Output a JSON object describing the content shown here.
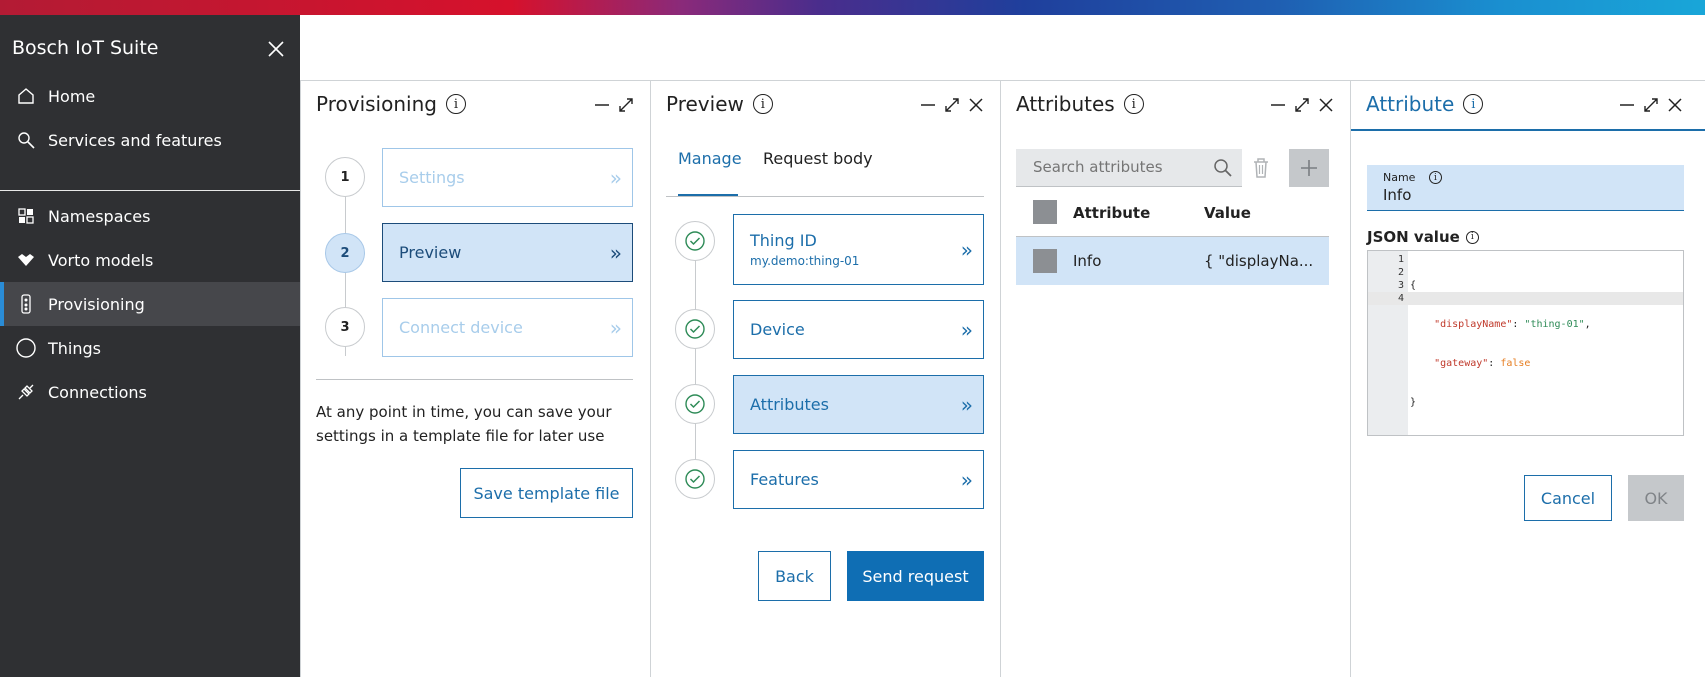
{
  "sidebar": {
    "brand": "Bosch IoT Suite",
    "items": [
      {
        "label": "Home",
        "icon": "home-icon"
      },
      {
        "label": "Services and features",
        "icon": "search-icon"
      },
      {
        "label": "Namespaces",
        "icon": "namespaces-icon"
      },
      {
        "label": "Vorto models",
        "icon": "vorto-icon"
      },
      {
        "label": "Provisioning",
        "icon": "provisioning-icon",
        "active": true
      },
      {
        "label": "Things",
        "icon": "things-icon"
      },
      {
        "label": "Connections",
        "icon": "connections-icon"
      }
    ]
  },
  "provisioning": {
    "title": "Provisioning",
    "steps": [
      {
        "number": "1",
        "label": "Settings"
      },
      {
        "number": "2",
        "label": "Preview"
      },
      {
        "number": "3",
        "label": "Connect device"
      }
    ],
    "note": "At any point in time, you can save your settings in a template file for later use",
    "save_label": "Save template file"
  },
  "preview": {
    "title": "Preview",
    "tabs": [
      "Manage",
      "Request body"
    ],
    "items": [
      {
        "label": "Thing ID",
        "sub": "my.demo:thing-01"
      },
      {
        "label": "Device"
      },
      {
        "label": "Attributes"
      },
      {
        "label": "Features"
      }
    ],
    "back_label": "Back",
    "send_label": "Send request"
  },
  "attributes": {
    "title": "Attributes",
    "search_placeholder": "Search attributes",
    "columns": [
      "Attribute",
      "Value"
    ],
    "rows": [
      {
        "attribute": "Info",
        "value": "{ \"displayNa..."
      }
    ]
  },
  "attribute": {
    "title": "Attribute",
    "name_label": "Name",
    "name_value": "Info",
    "json_label": "JSON value",
    "json_lines": [
      "1",
      "2",
      "3",
      "4"
    ],
    "json_code": {
      "open": "{",
      "key1": "\"displayName\"",
      "val1": "\"thing-01\"",
      "key2": "\"gateway\"",
      "val2": "false",
      "close": "}"
    },
    "cancel_label": "Cancel",
    "ok_label": "OK"
  },
  "colors": {
    "accent": "#1c6eaa",
    "sidebar_bg": "#2f3033",
    "selected_bg": "#d1e4f7"
  }
}
